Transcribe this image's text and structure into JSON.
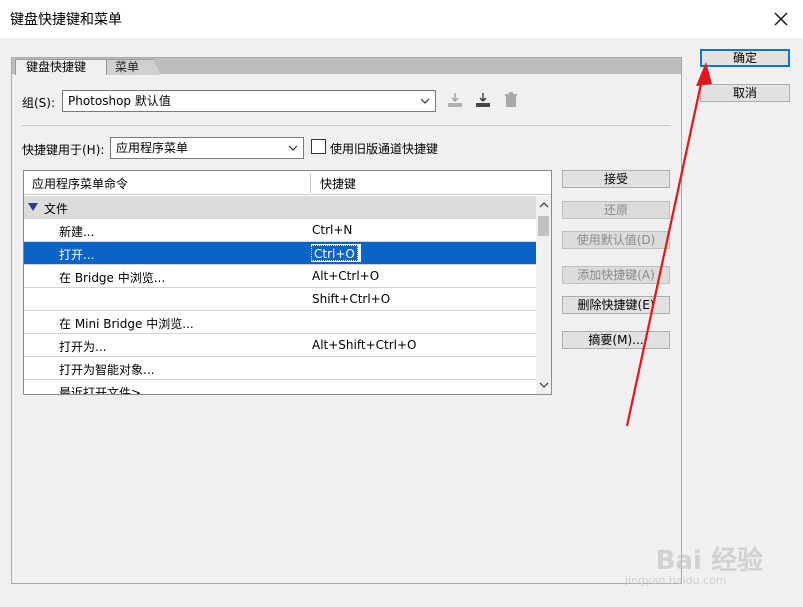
{
  "window": {
    "title": "键盘快捷键和菜单"
  },
  "tabs": [
    {
      "label": "键盘快捷键",
      "active": true
    },
    {
      "label": "菜单",
      "active": false
    }
  ],
  "group": {
    "label": "组(S):",
    "value": "Photoshop 默认值"
  },
  "shortcuts_for": {
    "label": "快捷键用于(H):",
    "value": "应用程序菜单"
  },
  "legacy_checkbox": {
    "label": "使用旧版通道快捷键",
    "checked": false
  },
  "table": {
    "headers": [
      "应用程序菜单命令",
      "快捷键"
    ],
    "rows": [
      {
        "cmd": "文件",
        "key": "",
        "type": "group"
      },
      {
        "cmd": "新建...",
        "key": "Ctrl+N",
        "type": "item"
      },
      {
        "cmd": "打开...",
        "key": "Ctrl+O",
        "type": "selected"
      },
      {
        "cmd": "在 Bridge 中浏览...",
        "key": "Alt+Ctrl+O",
        "type": "item"
      },
      {
        "cmd": "",
        "key": "Shift+Ctrl+O",
        "type": "item"
      },
      {
        "cmd": "在 Mini Bridge 中浏览...",
        "key": "",
        "type": "item"
      },
      {
        "cmd": "打开为...",
        "key": "Alt+Shift+Ctrl+O",
        "type": "item"
      },
      {
        "cmd": "打开为智能对象...",
        "key": "",
        "type": "item"
      },
      {
        "cmd": "最近打开文件>",
        "key": "",
        "type": "item"
      }
    ]
  },
  "side_buttons": {
    "accept": "接受",
    "undo": "还原",
    "use_default": "使用默认值(D)",
    "add_shortcut": "添加快捷键(A)",
    "delete_shortcut": "删除快捷键(E)",
    "summarize": "摘要(M)..."
  },
  "dialog_buttons": {
    "ok": "确定",
    "cancel": "取消"
  },
  "watermark": {
    "logo": "Bai 经验",
    "url": "jingyan.baidu.com"
  },
  "colors": {
    "selection": "#0a64c8",
    "annotation_arrow": "#e8141c",
    "default_button_border": "#0078d7"
  }
}
